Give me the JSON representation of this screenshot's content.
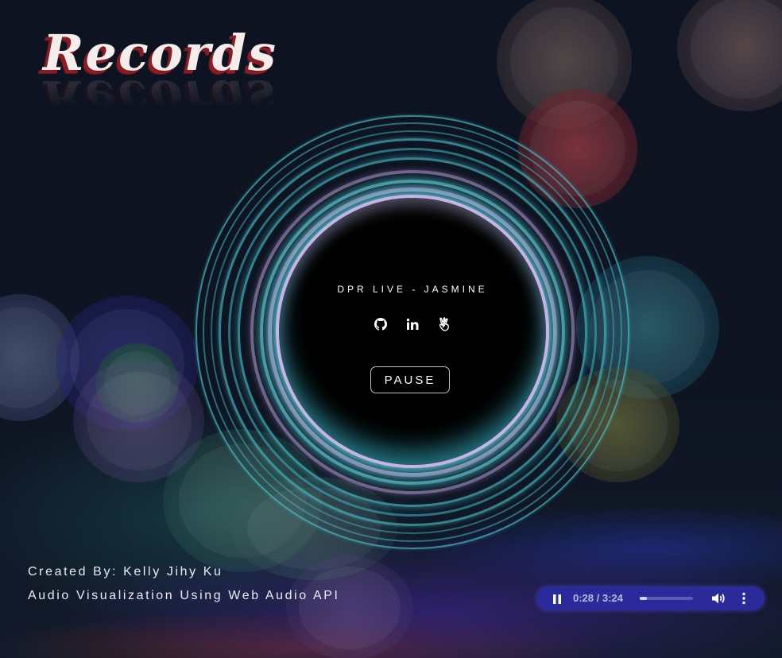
{
  "app": {
    "logo_text": "Records"
  },
  "now_playing": {
    "title": "DPR LIVE - JASMINE",
    "pause_label": "PAUSE"
  },
  "social_links": [
    {
      "icon": "github-icon"
    },
    {
      "icon": "linkedin-icon"
    },
    {
      "icon": "angellist-icon"
    }
  ],
  "footer": {
    "author": "Created By: Kelly Jihy Ku",
    "subtitle": "Audio Visualization Using Web Audio API"
  },
  "audio_player": {
    "time": "0:28 / 3:24",
    "progress_fraction": 0.137,
    "state": "playing",
    "play_icon": "pause-icon",
    "volume_icon": "volume-icon",
    "menu_icon": "more-vertical-icon"
  },
  "colors": {
    "accent_cyan": "#5fe3ef",
    "accent_lavender": "#c9b3e6",
    "logo_shadow": "#8a1c24",
    "player_bg": "#2a2a9a"
  }
}
